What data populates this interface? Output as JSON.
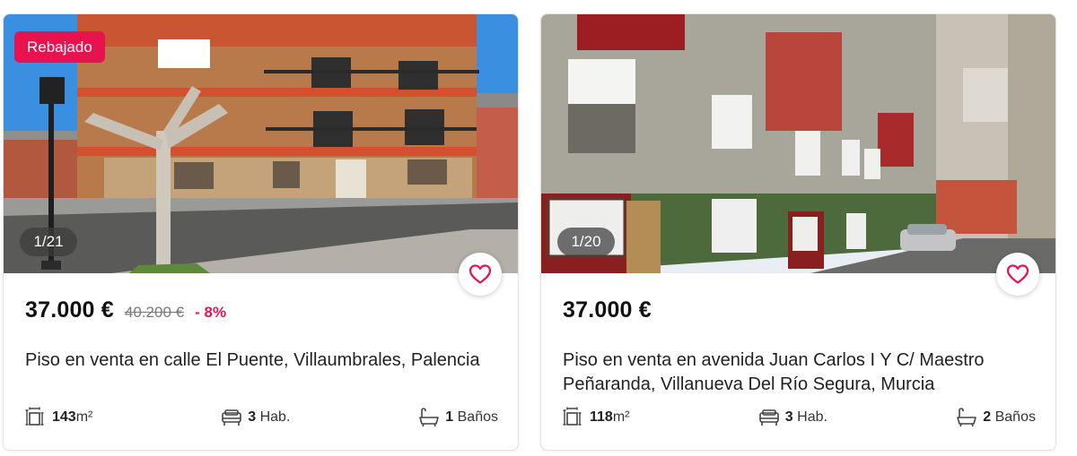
{
  "listings": [
    {
      "badge": "Rebajado",
      "photo_counter": "1/21",
      "price": "37.000 €",
      "old_price": "40.200 €",
      "discount": "- 8%",
      "title": "Piso en venta en calle El Puente, Villaumbrales, Palencia",
      "area_value": "143",
      "area_unit": "m²",
      "rooms_value": "3",
      "rooms_unit": "Hab.",
      "baths_value": "1",
      "baths_unit": "Baños"
    },
    {
      "photo_counter": "1/20",
      "price": "37.000 €",
      "title": "Piso en venta en avenida Juan Carlos I Y C/ Maestro Peñaranda, Villanueva Del Río Segura, Murcia",
      "area_value": "118",
      "area_unit": "m²",
      "rooms_value": "3",
      "rooms_unit": "Hab.",
      "baths_value": "2",
      "baths_unit": "Baños"
    }
  ],
  "icons": {
    "favorite": "heart-icon",
    "area": "area-icon",
    "rooms": "bed-icon",
    "baths": "bathtub-icon"
  },
  "colors": {
    "accent": "#e8124f",
    "text": "#111111",
    "muted": "#7a7a7a"
  }
}
